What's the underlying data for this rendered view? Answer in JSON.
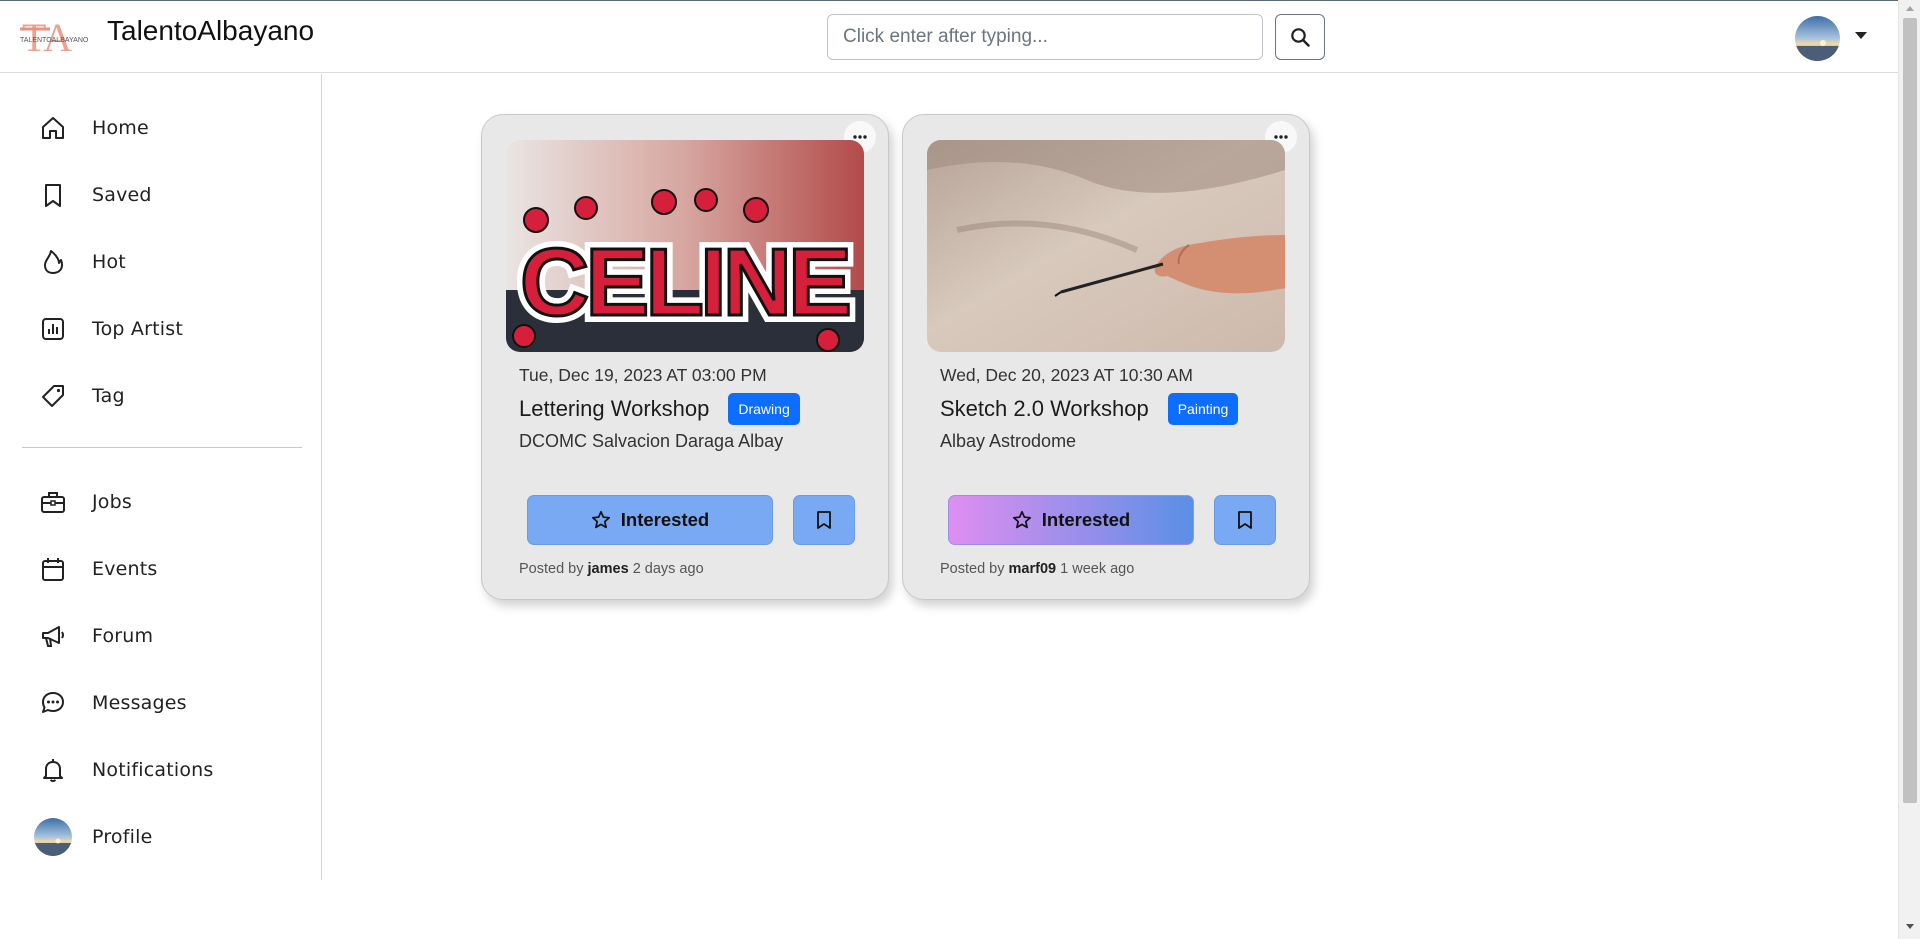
{
  "header": {
    "logo_text": "TALENTOALBAYANO",
    "logo_letters": "TA",
    "brand": "TalentoAlbayano",
    "search_placeholder": "Click enter after typing..."
  },
  "sidebar": {
    "items": [
      {
        "label": "Home",
        "icon": "home-icon"
      },
      {
        "label": "Saved",
        "icon": "bookmark-icon"
      },
      {
        "label": "Hot",
        "icon": "fire-icon"
      },
      {
        "label": "Top Artist",
        "icon": "bar-chart-icon"
      },
      {
        "label": "Tag",
        "icon": "tag-icon"
      },
      {
        "label": "Jobs",
        "icon": "briefcase-icon"
      },
      {
        "label": "Events",
        "icon": "calendar-icon"
      },
      {
        "label": "Forum",
        "icon": "megaphone-icon"
      },
      {
        "label": "Messages",
        "icon": "chat-dots-icon"
      },
      {
        "label": "Notifications",
        "icon": "bell-icon"
      },
      {
        "label": "Profile",
        "icon": "avatar"
      }
    ]
  },
  "cards": [
    {
      "image_text": "CELINE",
      "date": "Tue, Dec 19, 2023 AT 03:00 PM",
      "title": "Lettering Workshop",
      "badge": "Drawing",
      "venue": "DCOMC Salvacion Daraga Albay",
      "interested_label": "Interested",
      "posted_prefix": "Posted by",
      "author": "james",
      "posted_time": "2 days ago"
    },
    {
      "date": "Wed, Dec 20, 2023 AT 10:30 AM",
      "title": "Sketch 2.0 Workshop",
      "badge": "Painting",
      "venue": "Albay Astrodome",
      "interested_label": "Interested",
      "posted_prefix": "Posted by",
      "author": "marf09",
      "posted_time": "1 week ago"
    }
  ],
  "colors": {
    "badge": "#0d6efd",
    "interested_blue": "#7aa9f4",
    "interested_gradient_start": "#e08ef0",
    "interested_gradient_end": "#5b8fe6",
    "card_bg": "#e8e8e8"
  }
}
